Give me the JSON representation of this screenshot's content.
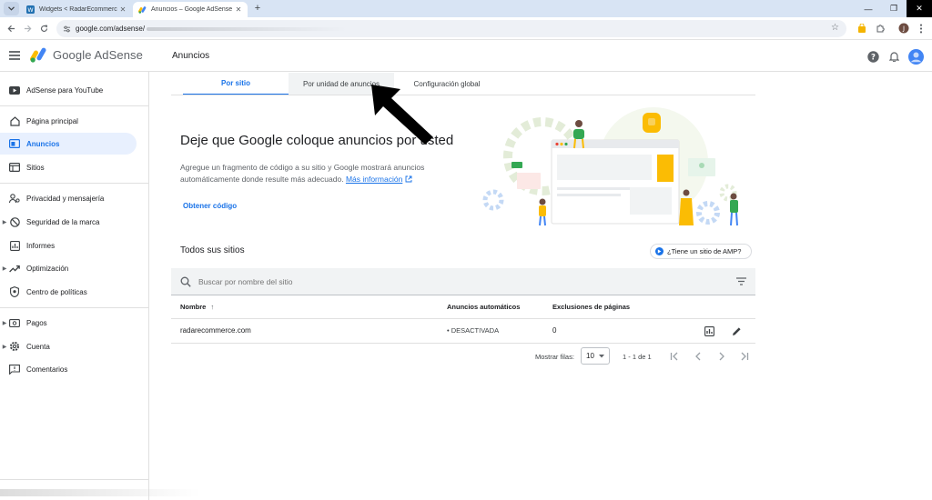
{
  "browser": {
    "tabs": [
      {
        "title": "Widgets < RadarEcommerce —",
        "active": false
      },
      {
        "title": "Anuncios – Google AdSense",
        "active": true
      }
    ],
    "new_tab": "+",
    "url": "google.com/adsense/",
    "window_controls": {
      "minimize": "—",
      "restore": "❐",
      "close": "✕"
    },
    "profile_initial": "J"
  },
  "app": {
    "product": "Google AdSense",
    "page_title": "Anuncios"
  },
  "sidebar": {
    "items": [
      {
        "label": "AdSense para YouTube",
        "icon": "youtube-icon",
        "expandable": false
      },
      {
        "label": "Página principal",
        "icon": "home-icon",
        "expandable": false
      },
      {
        "label": "Anuncios",
        "icon": "ads-icon",
        "expandable": false,
        "active": true
      },
      {
        "label": "Sitios",
        "icon": "sites-icon",
        "expandable": false
      },
      {
        "label": "Privacidad y mensajería",
        "icon": "privacy-icon",
        "expandable": false
      },
      {
        "label": "Seguridad de la marca",
        "icon": "block-icon",
        "expandable": true
      },
      {
        "label": "Informes",
        "icon": "reports-icon",
        "expandable": false
      },
      {
        "label": "Optimización",
        "icon": "trending-icon",
        "expandable": true
      },
      {
        "label": "Centro de políticas",
        "icon": "policy-icon",
        "expandable": false
      },
      {
        "label": "Pagos",
        "icon": "payments-icon",
        "expandable": true
      },
      {
        "label": "Cuenta",
        "icon": "gear-icon",
        "expandable": true
      },
      {
        "label": "Comentarios",
        "icon": "feedback-icon",
        "expandable": false
      }
    ]
  },
  "tabs": [
    {
      "label": "Por sitio",
      "active": true
    },
    {
      "label": "Por unidad de anuncios",
      "active": false
    },
    {
      "label": "Configuración global",
      "active": false
    }
  ],
  "hero": {
    "title": "Deje que Google coloque anuncios por usted",
    "description": "Agregue un fragmento de código a su sitio y Google mostrará anuncios automáticamente donde resulte más adecuado.",
    "more_info_link": "Más información",
    "cta": "Obtener código"
  },
  "sites": {
    "heading": "Todos sus sitios",
    "amp_chip": "¿Tiene un sitio de AMP?",
    "search_placeholder": "Buscar por nombre del sitio",
    "columns": {
      "name": "Nombre",
      "sort_arrow": "↑",
      "auto_ads": "Anuncios automáticos",
      "exclusions": "Exclusiones de páginas"
    },
    "rows": [
      {
        "name": "radarecommerce.com",
        "auto_ads": "• DESACTIVADA",
        "exclusions": "0"
      }
    ],
    "pagination": {
      "rows_label": "Mostrar filas:",
      "rows_value": "10",
      "range": "1 - 1 de 1"
    }
  },
  "colors": {
    "accent": "#1a73e8",
    "active_nav_bg": "#e8f0fe",
    "browser_tabstrip": "#d8e4f4"
  }
}
